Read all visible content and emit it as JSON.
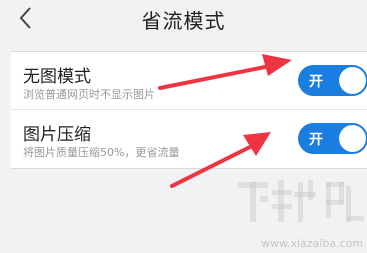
{
  "header": {
    "title": "省流模式",
    "back_icon": "chevron-left-icon"
  },
  "settings": [
    {
      "title": "无图模式",
      "description": "浏览普通网页时不显示图片",
      "toggle_label": "开",
      "enabled": true
    },
    {
      "title": "图片压缩",
      "description": "将图片质量压缩50%，更省流量",
      "toggle_label": "开",
      "enabled": true
    }
  ],
  "colors": {
    "accent": "#1a7de0",
    "arrow": "#ee3342"
  },
  "watermark": {
    "url": "www.xiazaiba.com"
  }
}
